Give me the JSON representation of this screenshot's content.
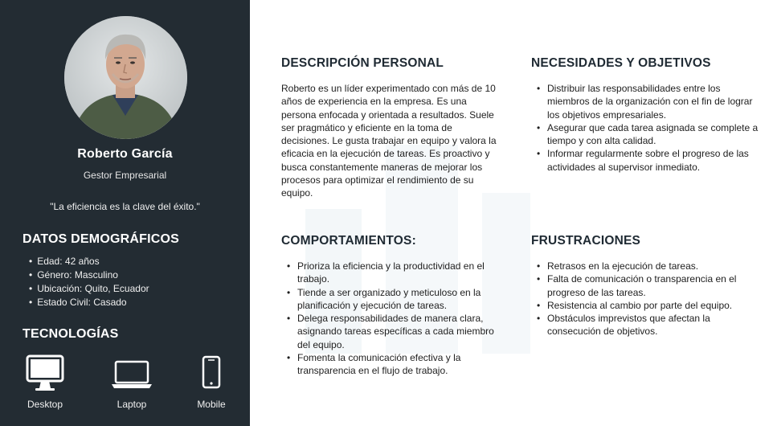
{
  "profile": {
    "name": "Roberto García",
    "role": "Gestor Empresarial",
    "quote": "\"La eficiencia es la clave del éxito.\""
  },
  "demographics": {
    "heading": "DATOS DEMOGRÁFICOS",
    "items": [
      "Edad: 42 años",
      "Género: Masculino",
      "Ubicación: Quito, Ecuador",
      "Estado Civil: Casado"
    ]
  },
  "technologies": {
    "heading": "TECNOLOGÍAS",
    "items": [
      {
        "label": "Desktop",
        "icon": "desktop-icon"
      },
      {
        "label": "Laptop",
        "icon": "laptop-icon"
      },
      {
        "label": "Mobile",
        "icon": "mobile-icon"
      }
    ]
  },
  "description": {
    "heading": "DESCRIPCIÓN PERSONAL",
    "text": "Roberto es un líder experimentado con más de 10 años de experiencia en la empresa. Es una persona enfocada y orientada a resultados. Suele ser pragmático y eficiente en la toma de decisiones. Le gusta trabajar en equipo y valora la eficacia en la ejecución de tareas. Es proactivo y busca constantemente maneras de mejorar los procesos para optimizar el rendimiento de su equipo."
  },
  "needs": {
    "heading": "NECESIDADES Y OBJETIVOS",
    "items": [
      "Distribuir las responsabilidades entre los miembros de la organización con el fin de lograr los objetivos empresariales.",
      "Asegurar que cada tarea asignada se complete a tiempo y con alta calidad.",
      "Informar regularmente sobre el progreso de las actividades al supervisor inmediato."
    ]
  },
  "behaviors": {
    "heading": "COMPORTAMIENTOS:",
    "items": [
      "Prioriza la eficiencia y la productividad en el trabajo.",
      "Tiende a ser organizado y meticuloso en la planificación y ejecución de tareas.",
      "Delega responsabilidades de manera clara, asignando tareas específicas a cada miembro del equipo.",
      "Fomenta la comunicación efectiva y la transparencia en el flujo de trabajo."
    ]
  },
  "frustrations": {
    "heading": "FRUSTRACIONES",
    "items": [
      "Retrasos en la ejecución de tareas.",
      "Falta de comunicación o transparencia en el progreso de las tareas.",
      "Resistencia al cambio por parte del equipo.",
      "Obstáculos imprevistos que afectan la consecución de objetivos."
    ]
  },
  "colors": {
    "sidebar": "#232c33",
    "heading": "#1f2a33",
    "text": "#1e1e1e"
  }
}
